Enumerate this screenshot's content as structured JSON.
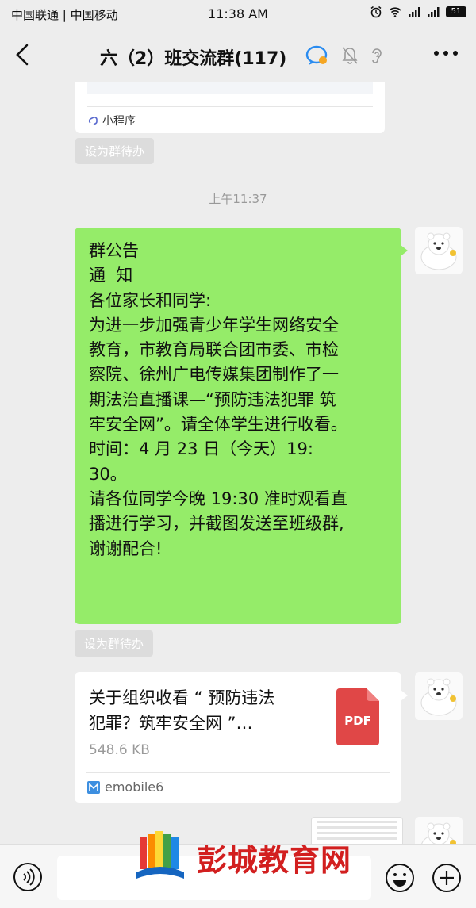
{
  "status_bar": {
    "carrier": "中国联通 | 中国移动",
    "time": "11:38 AM",
    "battery": "51"
  },
  "header": {
    "title": "六（2）班交流群(117)"
  },
  "messages": {
    "card_top": {
      "source": "小程序",
      "todo": "设为群待办"
    },
    "timestamp": "上午11:37",
    "notice": {
      "lines": [
        "群公告",
        "通  知",
        "各位家长和同学:",
        "为进一步加强青少年学生网络安全",
        "教育，市教育局联合团市委、市检",
        "察院、徐州广电传媒集团制作了一",
        "期法治直播课—“预防违法犯罪 筑",
        "牢安全网”。请全体学生进行收看。",
        "时间：4 月 23 日（今天）19:",
        "30。",
        "请各位同学今晚 19:30 准时观看直",
        "播进行学习，并截图发送至班级群,",
        "谢谢配合!"
      ],
      "todo": "设为群待办"
    },
    "file": {
      "title_line1": "关于组织收看 “ 预防违法",
      "title_line2": "犯罪？筑牢安全网 ”…",
      "size": "548.6 KB",
      "pdf_label": "PDF",
      "app": "emobile6"
    }
  },
  "watermark": {
    "text": "彭城教育网"
  },
  "colors": {
    "bubble_green": "#95ec69",
    "pdf_red": "#e04747",
    "background": "#ededed"
  }
}
